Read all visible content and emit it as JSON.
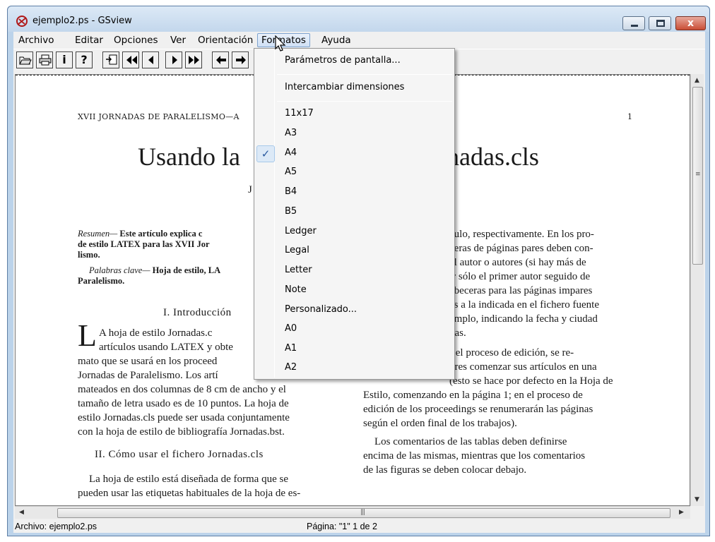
{
  "window": {
    "title": "ejemplo2.ps - GSview",
    "controls": {
      "minimize": "",
      "maximize": "",
      "close": "x"
    }
  },
  "menubar": {
    "items": [
      "Archivo",
      "Editar",
      "Opciones",
      "Ver",
      "Orientación",
      "Formatos",
      "Ayuda"
    ],
    "active": "Formatos"
  },
  "toolbar": {
    "buttons": [
      "open-icon",
      "print-icon",
      "info-icon",
      "help-icon",
      "goto-page-icon",
      "first-page-icon",
      "prev-page-icon",
      "next-page-icon",
      "last-page-icon",
      "back-icon",
      "forward-icon"
    ],
    "info_label": "i",
    "help_label": "?"
  },
  "document": {
    "running_head": "XVII JORNADAS DE PARALELISMO—A",
    "page_number": "1",
    "title_left": "Usando la",
    "title_right": "rnadas.cls",
    "author_initial": "J",
    "abstract_label": "Resumen—",
    "abstract_text": " Este artículo explica c",
    "abstract_line2": "de estilo LATEX para las XVII Jor",
    "abstract_line3": "lismo.",
    "keywords_label": "Palabras clave—",
    "keywords_text": " Hoja de estilo, LA",
    "keywords_line2": "Paralelismo.",
    "section1": "I. Introducción",
    "dropcap": "L",
    "intro_lines": [
      "A hoja de estilo Jornadas.c",
      "artículos usando LATEX y obte",
      "mato que se usará en los proceed",
      "Jornadas de Paralelismo. Los artí",
      "mateados en dos columnas de 8 cm de ancho y el",
      "tamaño de letra usado es de 10 puntos. La hoja de",
      "estilo Jornadas.cls puede ser usada conjuntamente",
      "con la hoja de estilo de bibliografía Jornadas.bst."
    ],
    "section2": "II. Cómo usar el fichero Jornadas.cls",
    "sec2_lines": [
      "La hoja de estilo está diseñada de forma que se",
      "pueden usar las etiquetas habituales de la hoja de es-"
    ],
    "right_lines": [
      "culo, respectivamente. En los pro-",
      "ceras de páginas pares deben con-",
      "el autor o autores (si hay más de",
      "ir sólo el primer autor seguido de",
      "abeceras para las páginas impares",
      "as a la indicada en el fichero fuente",
      "emplo, indicando la fecha y ciudad",
      "das.",
      "r el proceso de edición, se re-",
      "ores comenzar sus artículos en una",
      "(esto se hace por defecto en la Hoja de",
      "Estilo, comenzando en la página 1; en el proceso de",
      "edición de los proceedings se renumerarán las páginas",
      "según el orden final de los trabajos).",
      "Los comentarios de las tablas deben definirse",
      "encima de las mismas, mientras que los comentarios",
      "de las figuras se deben colocar debajo."
    ]
  },
  "formatos_menu": {
    "items": [
      "Parámetros de pantalla...",
      "Intercambiar dimensiones",
      "11x17",
      "A3",
      "A4",
      "A5",
      "B4",
      "B5",
      "Ledger",
      "Legal",
      "Letter",
      "Note",
      "Personalizado...",
      "A0",
      "A1",
      "A2"
    ],
    "checked": "A4",
    "check_glyph": "✓"
  },
  "statusbar": {
    "file": "Archivo: ejemplo2.ps",
    "page": "Página: \"1\"  1 de 2"
  }
}
